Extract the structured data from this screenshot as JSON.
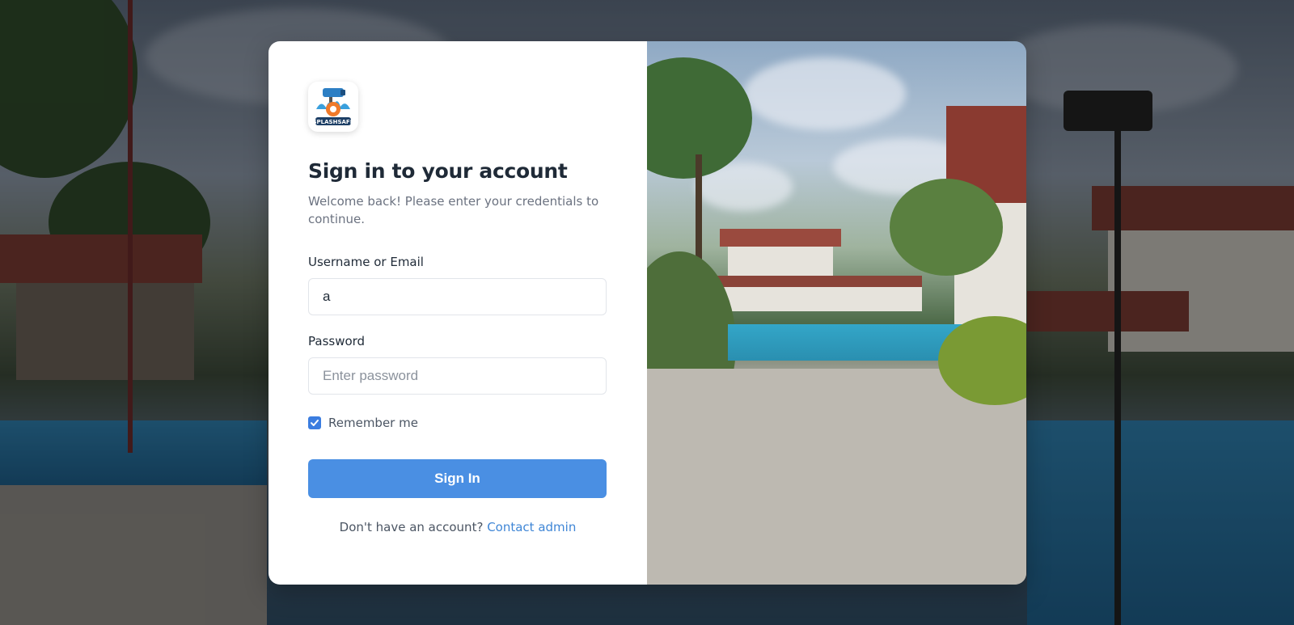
{
  "brand": {
    "logo_icon": "splashsafe-logo-icon",
    "logo_text": "SPLASHSAFE"
  },
  "login": {
    "title": "Sign in to your account",
    "subtitle": "Welcome back! Please enter your credentials to continue.",
    "username_label": "Username or Email",
    "username_value": "a",
    "password_label": "Password",
    "password_placeholder": "Enter password",
    "password_value": "",
    "remember_label": "Remember me",
    "remember_checked": true,
    "signin_label": "Sign In",
    "footer_prompt": "Don't have an account?",
    "footer_link": "Contact admin"
  },
  "colors": {
    "primary": "#4a8fe3",
    "link": "#3f86d6",
    "title": "#1f2a37",
    "muted": "#6b7280"
  }
}
